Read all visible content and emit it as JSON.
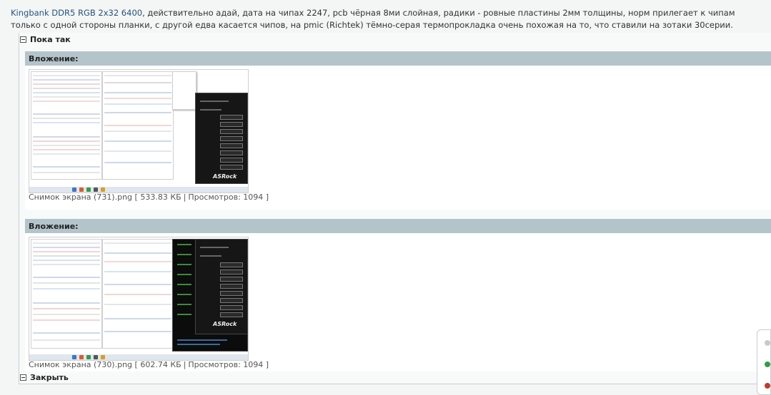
{
  "post": {
    "link_text": "Kingbank DDR5 RGB 2x32 6400",
    "body_text": ", действительно адай, дата на чипах 2247, pcb чёрная 8ми слойная, радики - ровные пластины 2мм толщины, норм прилегает к чипам только с одной стороны планки, с другой едва касается чипов, на pmic (Richtek) тёмно-серая термопрокладка очень похожая на то, что ставили на зотаки 30серии."
  },
  "spoiler": {
    "title": "Пока так",
    "close_label": "Закрыть"
  },
  "attachments": [
    {
      "header": "Вложение:",
      "filename": "Снимок экрана (731).png",
      "size": "533.83 КБ",
      "views_label": "Просмотров:",
      "views": "1094"
    },
    {
      "header": "Вложение:",
      "filename": "Снимок экрана (730).png",
      "size": "602.74 КБ",
      "views_label": "Просмотров:",
      "views": "1094"
    }
  ],
  "thumb_brand": "ASRock",
  "colors": {
    "link": "#23557f",
    "attach_header": "#b4c4cb",
    "background": "#f4f5f5"
  }
}
